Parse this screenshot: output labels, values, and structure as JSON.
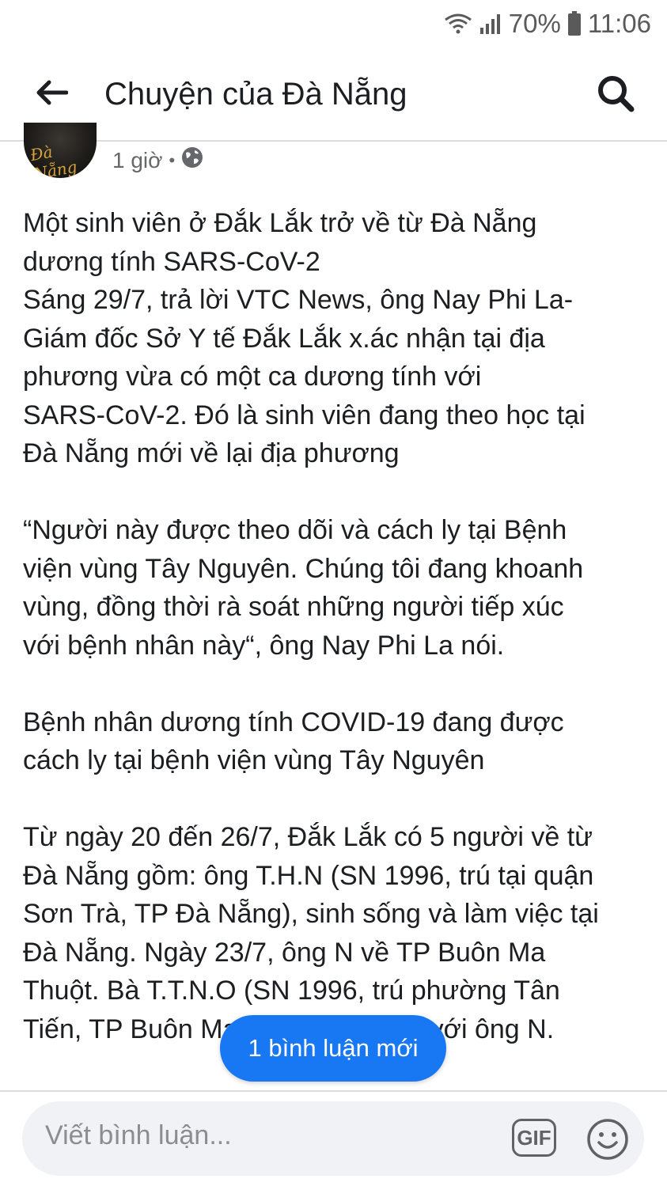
{
  "status_bar": {
    "battery_percent": "70%",
    "time": "11:06",
    "icons": [
      "wifi-icon",
      "signal-icon",
      "battery-icon"
    ]
  },
  "app_bar": {
    "title": "Chuyện của Đà Nẵng",
    "back_icon": "arrow-left-icon",
    "search_icon": "search-icon"
  },
  "post": {
    "avatar_text": "Đà Nẵng",
    "time_ago": "1 giờ",
    "separator": "•",
    "privacy_icon": "globe-icon",
    "lines": [
      "Một sinh viên ở Đắk Lắk trở về từ Đà Nẵng",
      "dương tính SARS-CoV-2",
      "Sáng 29/7, trả lời VTC News, ông Nay Phi La-",
      "Giám đốc Sở Y tế Đắk Lắk x.ác nhận tại địa",
      "phương vừa có một ca dương tính với",
      "SARS-CoV-2. Đó là sinh viên đang theo học tại",
      "Đà Nẵng mới về lại địa phương",
      "",
      "“Người này được theo dõi và cách ly tại Bệnh",
      "viện vùng Tây Nguyên. Chúng tôi đang khoanh",
      "vùng, đồng thời rà soát những người tiếp xúc",
      "với bệnh nhân này“, ông Nay Phi La nói.",
      "",
      "Bệnh nhân dương tính COVID-19 đang được",
      "cách ly tại bệnh viện vùng Tây Nguyên",
      "",
      "Từ ngày 20 đến 26/7, Đắk Lắk có 5 người về từ",
      "Đà Nẵng gồm: ông T.H.N (SN 1996, trú tại quận",
      "Sơn Trà, TP Đà Nẵng), sinh sống và làm việc tại",
      "Đà Nẵng. Ngày 23/7, ông N về TP Buôn Ma",
      "Thuột. Bà T.T.N.O (SN 1996, trú phường Tân",
      "Tiến, TP Buôn Ma Thuột) tiếp xúc với ông N."
    ]
  },
  "new_comment_banner": "1 bình luận mới",
  "composer": {
    "placeholder": "Viết bình luận...",
    "gif_label": "GIF",
    "emoji_icon": "smiley-icon"
  }
}
